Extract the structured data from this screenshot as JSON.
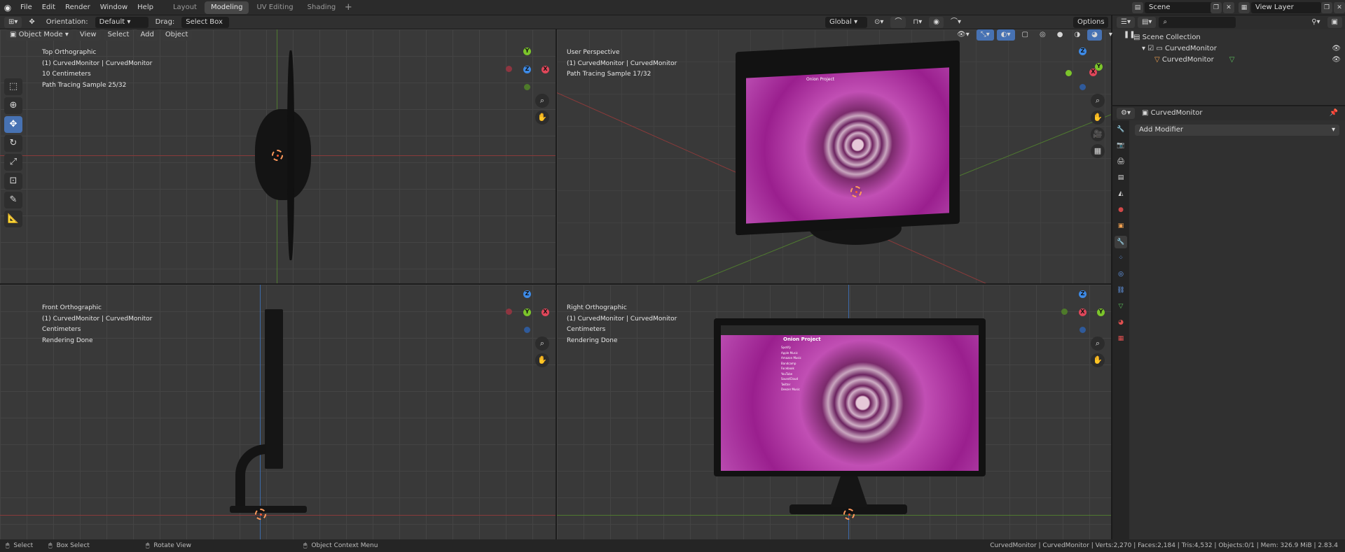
{
  "menu": {
    "file": "File",
    "edit": "Edit",
    "render": "Render",
    "window": "Window",
    "help": "Help"
  },
  "workspaces": [
    "Layout",
    "Modeling",
    "UV Editing",
    "Shading"
  ],
  "scene": {
    "label": "Scene",
    "view_layer": "View Layer"
  },
  "header": {
    "orientation_label": "Orientation:",
    "orientation_value": "Default",
    "drag_label": "Drag:",
    "drag_value": "Select Box",
    "transform_space": "Global",
    "options": "Options"
  },
  "viewport_header": {
    "mode": "Object Mode",
    "view": "View",
    "select": "Select",
    "add": "Add",
    "object": "Object"
  },
  "viewports": {
    "top": {
      "name": "Top Orthographic",
      "object": "(1) CurvedMonitor | CurvedMonitor",
      "scale": "10 Centimeters",
      "status": "Path Tracing Sample 25/32"
    },
    "user": {
      "name": "User Perspective",
      "object": "(1) CurvedMonitor | CurvedMonitor",
      "status": "Path Tracing Sample 17/32"
    },
    "front": {
      "name": "Front Orthographic",
      "object": "(1) CurvedMonitor | CurvedMonitor",
      "scale": "Centimeters",
      "status": "Rendering Done"
    },
    "right": {
      "name": "Right Orthographic",
      "object": "(1) CurvedMonitor | CurvedMonitor",
      "scale": "Centimeters",
      "status": "Rendering Done"
    }
  },
  "outliner": {
    "collection": "Scene Collection",
    "items": [
      {
        "label": "CurvedMonitor"
      },
      {
        "label": "CurvedMonitor"
      }
    ]
  },
  "properties": {
    "object_name": "CurvedMonitor",
    "add_modifier": "Add Modifier"
  },
  "screen_ui": {
    "title": "Onion Project",
    "menu": [
      "Spotify",
      "Apple Music",
      "Amazon Music",
      "Bandcamp",
      "Facebook",
      "YouTube",
      "SoundCloud",
      "Twitter",
      "Deezer Music"
    ]
  },
  "statusbar": {
    "select": "Select",
    "box_select": "Box Select",
    "rotate": "Rotate View",
    "context": "Object Context Menu",
    "stats": "CurvedMonitor | CurvedMonitor | Verts:2,270 | Faces:2,184 | Tris:4,532 | Objects:0/1 | Mem: 326.9 MiB | 2.83.4"
  },
  "colors": {
    "accent": "#4772b3",
    "axis_x": "#e0475a",
    "axis_y": "#7cc52b",
    "axis_z": "#3d8ae6",
    "screen": "#b93fb0"
  }
}
